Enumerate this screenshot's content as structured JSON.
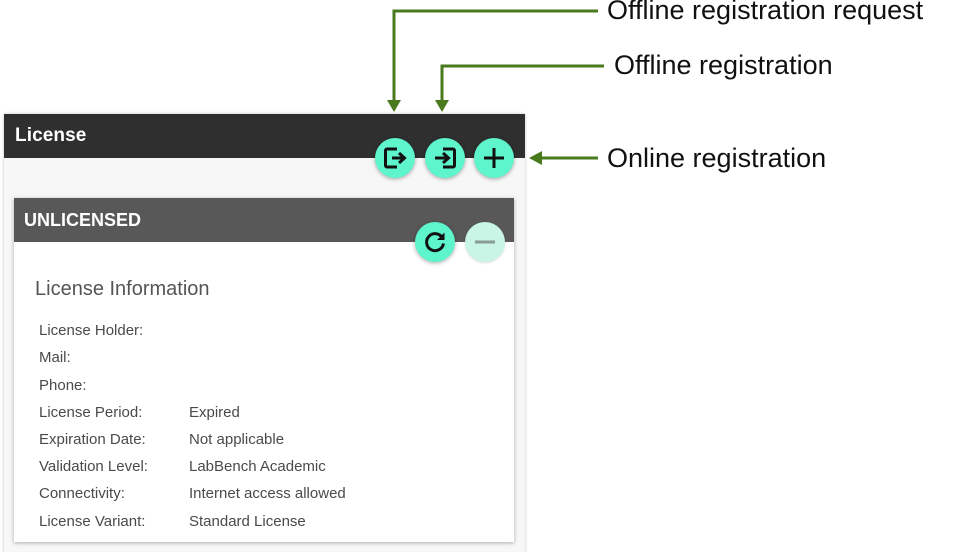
{
  "panel": {
    "title": "License"
  },
  "actions": {
    "offline_request_icon": "export-icon",
    "offline_registration_icon": "import-icon",
    "online_registration_icon": "plus-icon",
    "refresh_icon": "refresh-icon",
    "remove_icon": "minus-icon"
  },
  "license_card": {
    "status": "UNLICENSED",
    "section_title": "License Information",
    "rows": [
      {
        "label": "License Holder:",
        "value": ""
      },
      {
        "label": "Mail:",
        "value": ""
      },
      {
        "label": "Phone:",
        "value": ""
      },
      {
        "label": "License Period:",
        "value": "Expired"
      },
      {
        "label": "Expiration Date:",
        "value": "Not applicable"
      },
      {
        "label": "Validation Level:",
        "value": "LabBench Academic"
      },
      {
        "label": "Connectivity:",
        "value": "Internet access allowed"
      },
      {
        "label": "License Variant:",
        "value": "Standard License"
      }
    ]
  },
  "annotations": {
    "offline_request": "Offline registration request",
    "offline_registration": "Offline registration",
    "online_registration": "Online registration"
  },
  "colors": {
    "accent": "#5ef5cc",
    "arrow": "#4a7a1e",
    "panel_header": "#2f2f2f",
    "card_header": "#585858"
  }
}
